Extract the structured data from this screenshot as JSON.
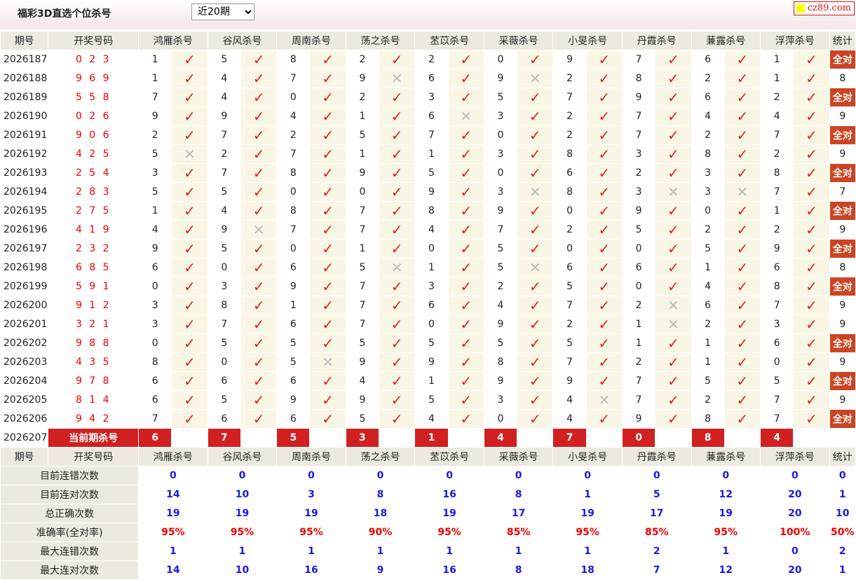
{
  "header": {
    "title": "福彩3D直选个位杀号",
    "period_selected": "近20期",
    "site": "cz89.com"
  },
  "columns": {
    "qihao": "期号",
    "kaijiang": "开奖号码",
    "experts": [
      "鸿雁杀号",
      "谷风杀号",
      "周南杀号",
      "荡之杀号",
      "苤苡杀号",
      "采薇杀号",
      "小旻杀号",
      "丹霞杀号",
      "蒹露杀号",
      "浮萍杀号"
    ],
    "tongji": "统计"
  },
  "colors": {
    "tick": "#e02020",
    "cross": "#bbbbbb",
    "accent": "#d02020",
    "stat_blue": "#1a1ae0"
  },
  "rows": [
    {
      "qi": "2026187",
      "kj": "0 2 3",
      "k": [
        1,
        5,
        8,
        2,
        2,
        0,
        9,
        7,
        6,
        1
      ],
      "r": [
        1,
        1,
        1,
        1,
        1,
        1,
        1,
        1,
        1,
        1
      ],
      "s": "全对"
    },
    {
      "qi": "2026188",
      "kj": "9 6 9",
      "k": [
        1,
        4,
        7,
        9,
        6,
        9,
        2,
        8,
        2,
        1
      ],
      "r": [
        1,
        1,
        1,
        0,
        1,
        0,
        1,
        1,
        1,
        1
      ],
      "s": "8"
    },
    {
      "qi": "2026189",
      "kj": "5 5 8",
      "k": [
        7,
        4,
        0,
        2,
        3,
        5,
        7,
        9,
        6,
        2
      ],
      "r": [
        1,
        1,
        1,
        1,
        1,
        1,
        1,
        1,
        1,
        1
      ],
      "s": "全对"
    },
    {
      "qi": "2026190",
      "kj": "0 2 6",
      "k": [
        9,
        9,
        4,
        1,
        6,
        3,
        2,
        7,
        4,
        4
      ],
      "r": [
        1,
        1,
        1,
        1,
        0,
        1,
        1,
        1,
        1,
        1
      ],
      "s": "9"
    },
    {
      "qi": "2026191",
      "kj": "9 0 6",
      "k": [
        2,
        7,
        2,
        5,
        7,
        0,
        2,
        7,
        2,
        7
      ],
      "r": [
        1,
        1,
        1,
        1,
        1,
        1,
        1,
        1,
        1,
        1
      ],
      "s": "全对"
    },
    {
      "qi": "2026192",
      "kj": "4 2 5",
      "k": [
        5,
        2,
        7,
        1,
        1,
        3,
        8,
        3,
        8,
        2
      ],
      "r": [
        0,
        1,
        1,
        1,
        1,
        1,
        1,
        1,
        1,
        1
      ],
      "s": "9"
    },
    {
      "qi": "2026193",
      "kj": "2 5 4",
      "k": [
        3,
        7,
        8,
        9,
        5,
        0,
        6,
        2,
        3,
        8
      ],
      "r": [
        1,
        1,
        1,
        1,
        1,
        1,
        1,
        1,
        1,
        1
      ],
      "s": "全对"
    },
    {
      "qi": "2026194",
      "kj": "2 8 3",
      "k": [
        5,
        5,
        0,
        0,
        9,
        3,
        8,
        3,
        3,
        7
      ],
      "r": [
        1,
        1,
        1,
        1,
        1,
        0,
        1,
        0,
        0,
        1
      ],
      "s": "7"
    },
    {
      "qi": "2026195",
      "kj": "2 7 5",
      "k": [
        1,
        4,
        8,
        7,
        8,
        9,
        0,
        9,
        0,
        1
      ],
      "r": [
        1,
        1,
        1,
        1,
        1,
        1,
        1,
        1,
        1,
        1
      ],
      "s": "全对"
    },
    {
      "qi": "2026196",
      "kj": "4 1 9",
      "k": [
        4,
        9,
        7,
        7,
        4,
        7,
        2,
        5,
        2,
        2
      ],
      "r": [
        1,
        0,
        1,
        1,
        1,
        1,
        1,
        1,
        1,
        1
      ],
      "s": "9"
    },
    {
      "qi": "2026197",
      "kj": "2 3 2",
      "k": [
        9,
        5,
        0,
        1,
        0,
        5,
        0,
        0,
        5,
        9
      ],
      "r": [
        1,
        1,
        1,
        1,
        1,
        1,
        1,
        1,
        1,
        1
      ],
      "s": "全对"
    },
    {
      "qi": "2026198",
      "kj": "6 8 5",
      "k": [
        6,
        0,
        6,
        5,
        1,
        5,
        6,
        6,
        1,
        6
      ],
      "r": [
        1,
        1,
        1,
        0,
        1,
        0,
        1,
        1,
        1,
        1
      ],
      "s": "8"
    },
    {
      "qi": "2026199",
      "kj": "5 9 1",
      "k": [
        0,
        3,
        9,
        7,
        3,
        2,
        5,
        0,
        4,
        8
      ],
      "r": [
        1,
        1,
        1,
        1,
        1,
        1,
        1,
        1,
        1,
        1
      ],
      "s": "全对"
    },
    {
      "qi": "2026200",
      "kj": "9 1 2",
      "k": [
        3,
        8,
        1,
        7,
        6,
        4,
        7,
        2,
        6,
        7
      ],
      "r": [
        1,
        1,
        1,
        1,
        1,
        1,
        1,
        0,
        1,
        1
      ],
      "s": "9"
    },
    {
      "qi": "2026201",
      "kj": "3 2 1",
      "k": [
        3,
        7,
        6,
        7,
        0,
        9,
        2,
        1,
        2,
        3
      ],
      "r": [
        1,
        1,
        1,
        1,
        1,
        1,
        1,
        0,
        1,
        1
      ],
      "s": "9"
    },
    {
      "qi": "2026202",
      "kj": "9 8 8",
      "k": [
        0,
        5,
        5,
        5,
        5,
        5,
        5,
        1,
        1,
        6
      ],
      "r": [
        1,
        1,
        1,
        1,
        1,
        1,
        1,
        1,
        1,
        1
      ],
      "s": "全对"
    },
    {
      "qi": "2026203",
      "kj": "4 3 5",
      "k": [
        8,
        0,
        5,
        9,
        9,
        8,
        7,
        2,
        1,
        0
      ],
      "r": [
        1,
        1,
        0,
        1,
        1,
        1,
        1,
        1,
        1,
        1
      ],
      "s": "9"
    },
    {
      "qi": "2026204",
      "kj": "9 7 8",
      "k": [
        6,
        6,
        6,
        4,
        1,
        9,
        9,
        7,
        5,
        5
      ],
      "r": [
        1,
        1,
        1,
        1,
        1,
        1,
        1,
        1,
        1,
        1
      ],
      "s": "全对"
    },
    {
      "qi": "2026205",
      "kj": "8 1 4",
      "k": [
        6,
        5,
        9,
        9,
        5,
        3,
        4,
        7,
        2,
        7
      ],
      "r": [
        1,
        1,
        1,
        1,
        1,
        1,
        0,
        1,
        1,
        1
      ],
      "s": "9"
    },
    {
      "qi": "2026206",
      "kj": "9 4 2",
      "k": [
        7,
        6,
        6,
        5,
        4,
        0,
        4,
        9,
        8,
        7
      ],
      "r": [
        1,
        1,
        1,
        1,
        1,
        1,
        1,
        1,
        1,
        1
      ],
      "s": "全对"
    }
  ],
  "current": {
    "qi": "2026207",
    "label": "当前期杀号",
    "kills": [
      6,
      7,
      5,
      3,
      1,
      4,
      7,
      0,
      8,
      4
    ]
  },
  "stats": [
    {
      "label": "目前连错次数",
      "v": [
        0,
        0,
        0,
        0,
        0,
        0,
        0,
        0,
        0,
        0
      ],
      "t": "0",
      "rate": false
    },
    {
      "label": "目前连对次数",
      "v": [
        14,
        10,
        3,
        8,
        16,
        8,
        1,
        5,
        12,
        20
      ],
      "t": "1",
      "rate": false
    },
    {
      "label": "总正确次数",
      "v": [
        19,
        19,
        19,
        18,
        19,
        17,
        19,
        17,
        19,
        20
      ],
      "t": "10",
      "rate": false
    },
    {
      "label": "准确率(全对率)",
      "v": [
        "95%",
        "95%",
        "95%",
        "90%",
        "95%",
        "85%",
        "95%",
        "85%",
        "95%",
        "100%"
      ],
      "t": "50%",
      "rate": true
    },
    {
      "label": "最大连错次数",
      "v": [
        1,
        1,
        1,
        1,
        1,
        1,
        1,
        2,
        1,
        0
      ],
      "t": "2",
      "rate": false
    },
    {
      "label": "最大连对次数",
      "v": [
        14,
        10,
        16,
        9,
        16,
        8,
        18,
        7,
        12,
        20
      ],
      "t": "1",
      "rate": false
    }
  ]
}
